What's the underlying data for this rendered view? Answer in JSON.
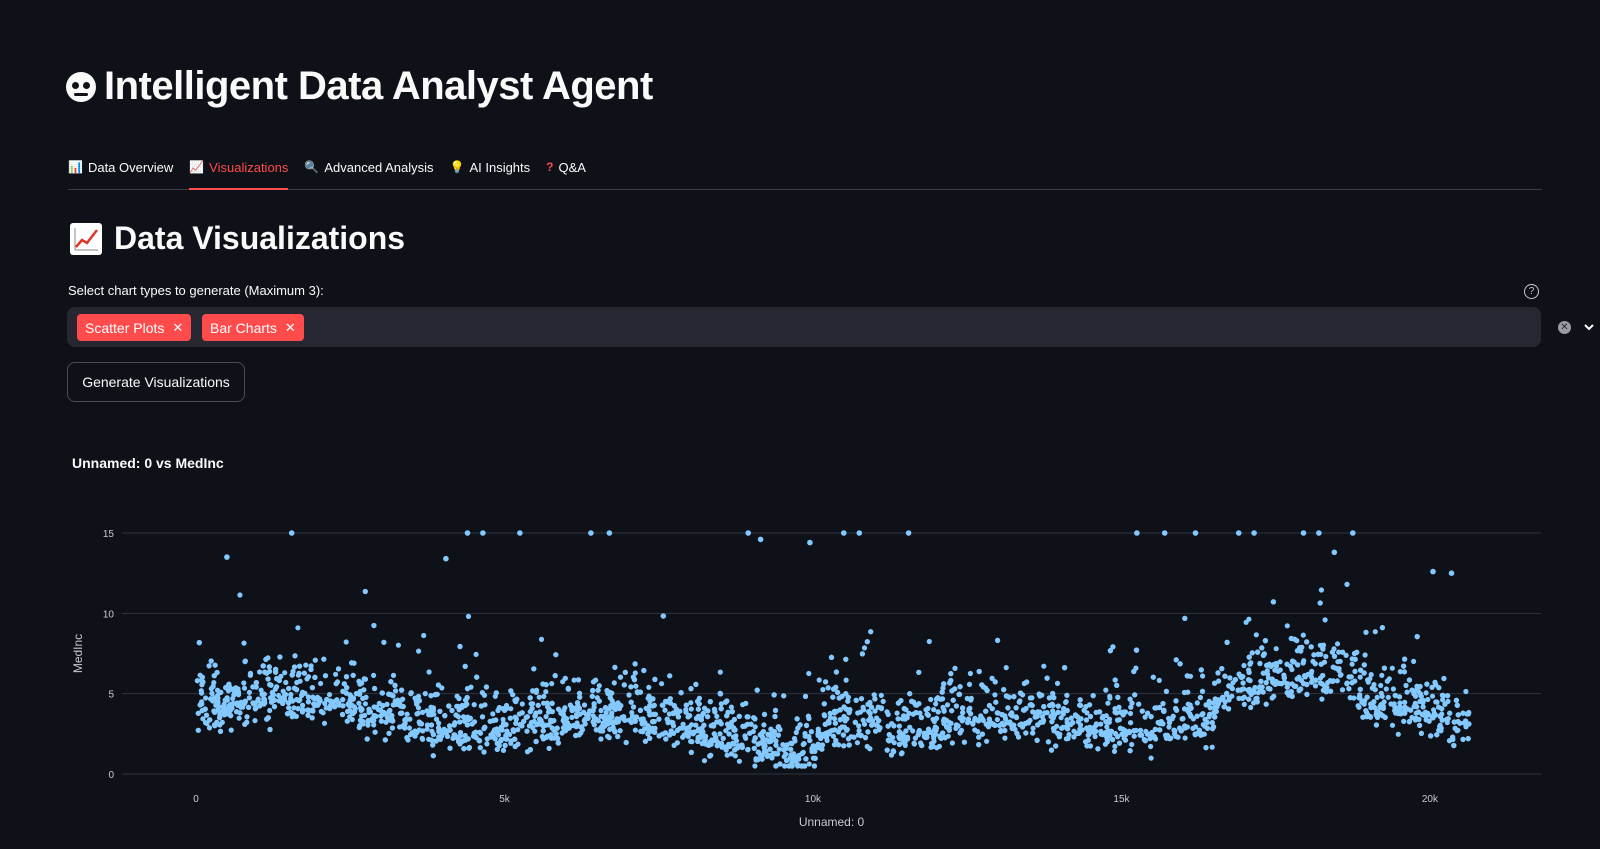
{
  "app": {
    "title": "Intelligent Data Analyst Agent",
    "title_icon": "robot-face-icon"
  },
  "tabs": [
    {
      "label": "Data Overview",
      "icon": "bar-chart-icon",
      "active": false
    },
    {
      "label": "Visualizations",
      "icon": "chart-increasing-icon",
      "active": true
    },
    {
      "label": "Advanced Analysis",
      "icon": "magnifier-icon",
      "active": false
    },
    {
      "label": "AI Insights",
      "icon": "light-bulb-icon",
      "active": false
    },
    {
      "label": "Q&A",
      "icon": "question-mark-icon",
      "active": false
    }
  ],
  "section": {
    "title": "Data Visualizations",
    "icon": "chart-increasing-icon"
  },
  "chart_type_select": {
    "label": "Select chart types to generate (Maximum 3):",
    "selected": [
      "Scatter Plots",
      "Bar Charts"
    ]
  },
  "generate_button": {
    "label": "Generate Visualizations"
  },
  "chart_data": {
    "type": "scatter",
    "title": "Unnamed: 0 vs MedInc",
    "xlabel": "Unnamed: 0",
    "ylabel": "MedInc",
    "xlim": [
      -1200,
      21800
    ],
    "ylim": [
      0,
      15
    ],
    "xticks": [
      0,
      5000,
      10000,
      15000,
      20000
    ],
    "xtick_labels": [
      "0",
      "5k",
      "10k",
      "15k",
      "20k"
    ],
    "yticks": [
      0,
      5,
      10,
      15
    ],
    "ytick_labels": [
      "0",
      "5",
      "10",
      "15"
    ],
    "point_color": "#83c9ff",
    "grid": "horizontal",
    "x_range_of_points": [
      0,
      20640
    ],
    "peak_values": [
      {
        "x": 500,
        "y": 13.5
      },
      {
        "x": 1550,
        "y": 15
      },
      {
        "x": 4050,
        "y": 13.4
      },
      {
        "x": 4400,
        "y": 15
      },
      {
        "x": 4650,
        "y": 15
      },
      {
        "x": 5250,
        "y": 15
      },
      {
        "x": 6400,
        "y": 15
      },
      {
        "x": 6700,
        "y": 15
      },
      {
        "x": 8950,
        "y": 15
      },
      {
        "x": 9150,
        "y": 14.6
      },
      {
        "x": 9950,
        "y": 14.4
      },
      {
        "x": 10500,
        "y": 15
      },
      {
        "x": 10750,
        "y": 15
      },
      {
        "x": 11550,
        "y": 15
      },
      {
        "x": 15250,
        "y": 15
      },
      {
        "x": 15700,
        "y": 15
      },
      {
        "x": 16200,
        "y": 15
      },
      {
        "x": 16900,
        "y": 15
      },
      {
        "x": 17150,
        "y": 15
      },
      {
        "x": 17950,
        "y": 15
      },
      {
        "x": 18200,
        "y": 15
      },
      {
        "x": 18450,
        "y": 13.8
      },
      {
        "x": 18750,
        "y": 15
      },
      {
        "x": 20050,
        "y": 12.6
      },
      {
        "x": 20350,
        "y": 12.5
      }
    ]
  }
}
